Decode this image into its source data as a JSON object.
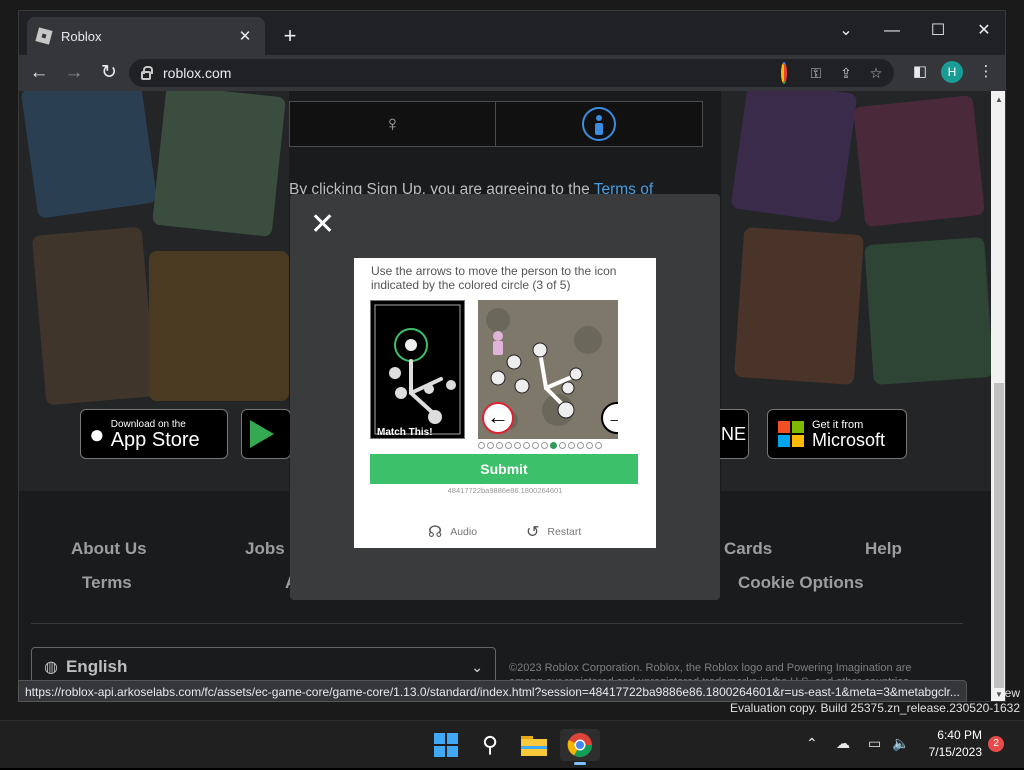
{
  "browser": {
    "tab_title": "Roblox",
    "tab_close": "✕",
    "new_tab": "+",
    "url": "roblox.com",
    "profile_initial": "H",
    "status_url": "https://roblox-api.arkoselabs.com/fc/assets/ec-game-core/game-core/1.13.0/standard/index.html?session=48417722ba9886e86.1800264601&r=us-east-1&meta=3&metabgclr..."
  },
  "page": {
    "agree_text": "By clicking Sign Up, you are agreeing to the ",
    "terms_link": "Terms of",
    "badges": {
      "appstore_small": "Download on the",
      "appstore_big": "App Store",
      "microsoft_small": "Get it from",
      "microsoft_big": "Microsoft",
      "partial": "NE"
    },
    "footer_links": {
      "about": "About Us",
      "jobs": "Jobs",
      "cards": "Cards",
      "help": "Help",
      "terms": "Terms",
      "a_partial": "A",
      "cookie": "Cookie Options"
    },
    "language": "English",
    "copyright_line1": "©2023 Roblox Corporation. Roblox, the Roblox logo and Powering Imagination are",
    "copyright_line2": "among our registered and unregistered trademarks in the U.S. and other countries."
  },
  "captcha": {
    "close": "✕",
    "instruction": "Use the arrows to move the person to the icon indicated by the colored circle (3 of 5)",
    "match_label": "Match This!",
    "submit": "Submit",
    "session": "48417722ba9886e86.1800264601",
    "audio": "Audio",
    "restart": "Restart",
    "progress": {
      "total": 14,
      "current_index": 8
    }
  },
  "os": {
    "watermark_line1": "ew",
    "watermark_line2": "Evaluation copy. Build 25375.zn_release.230520-1632",
    "time": "6:40 PM",
    "date": "7/15/2023",
    "notifications": "2"
  }
}
